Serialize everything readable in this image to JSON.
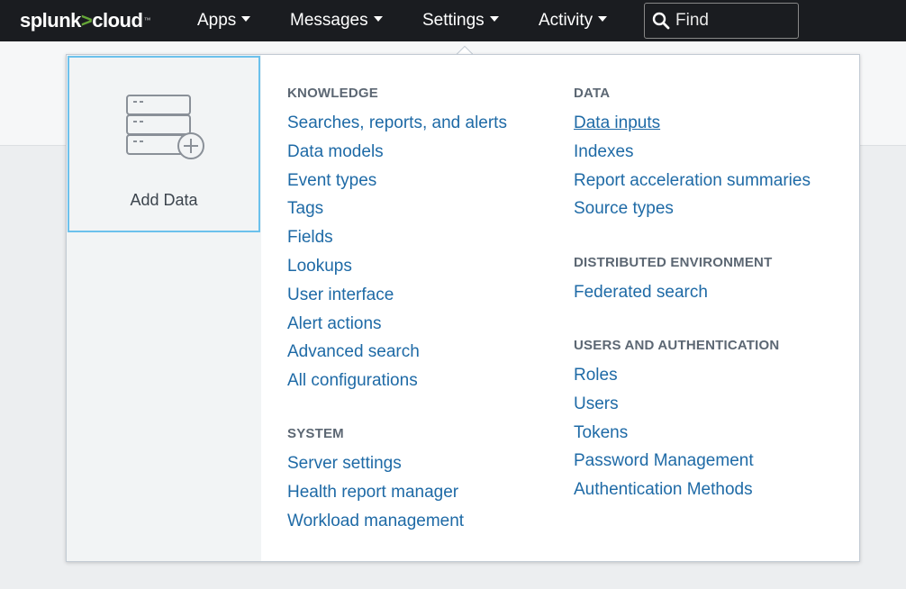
{
  "topbar": {
    "logo": {
      "left": "splunk",
      "separator": ">",
      "right": "cloud",
      "mark": "™"
    },
    "nav": [
      "Apps",
      "Messages",
      "Settings",
      "Activity"
    ],
    "search": {
      "placeholder": "Find",
      "value": ""
    }
  },
  "dropdown": {
    "add_data": {
      "label": "Add Data",
      "icon": "add-data-icon"
    },
    "knowledge": {
      "title": "KNOWLEDGE",
      "items": [
        "Searches, reports, and alerts",
        "Data models",
        "Event types",
        "Tags",
        "Fields",
        "Lookups",
        "User interface",
        "Alert actions",
        "Advanced search",
        "All configurations"
      ]
    },
    "system": {
      "title": "SYSTEM",
      "items": [
        "Server settings",
        "Health report manager",
        "Workload management"
      ]
    },
    "data": {
      "title": "DATA",
      "items": [
        "Data inputs",
        "Indexes",
        "Report acceleration summaries",
        "Source types"
      ]
    },
    "distributed": {
      "title": "DISTRIBUTED ENVIRONMENT",
      "items": [
        "Federated search"
      ]
    },
    "users": {
      "title": "USERS AND AUTHENTICATION",
      "items": [
        "Roles",
        "Users",
        "Tokens",
        "Password Management",
        "Authentication Methods"
      ]
    }
  },
  "colors": {
    "accent_link": "#1e6aa6",
    "logo_gt": "#65a637",
    "focus_border": "#6cc1ec",
    "topbar": "#1a1c20"
  }
}
